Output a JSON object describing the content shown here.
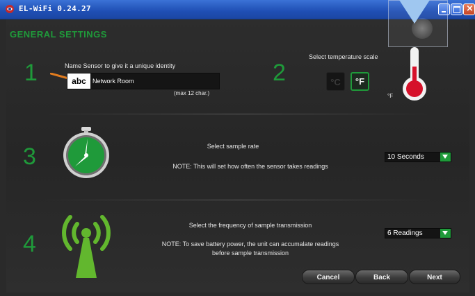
{
  "window": {
    "title": "EL-WiFi 0.24.27"
  },
  "page": {
    "title": "GENERAL SETTINGS"
  },
  "step1": {
    "number": "1",
    "label": "Name Sensor to give it a unique identity",
    "abc": "abc",
    "value": "Network Room",
    "hint": "(max 12 char.)"
  },
  "step2": {
    "number": "2",
    "label": "Select temperature scale",
    "option_c": "°C",
    "option_f": "°F",
    "selected": "°F",
    "unit_label": "°F"
  },
  "step3": {
    "number": "3",
    "label": "Select sample rate",
    "note": "NOTE: This will set how often the sensor takes readings",
    "selected": "10 Seconds"
  },
  "step4": {
    "number": "4",
    "label": "Select the frequency of sample transmission",
    "note_line1": "NOTE: To save battery power, the unit can accumalate readings",
    "note_line2": "before sample transmission",
    "selected": "6 Readings"
  },
  "buttons": {
    "cancel": "Cancel",
    "back": "Back",
    "next": "Next"
  },
  "colors": {
    "accent": "#1f9a3a",
    "titlebar": "#2a5ec6",
    "thermo_red": "#d6112a"
  }
}
